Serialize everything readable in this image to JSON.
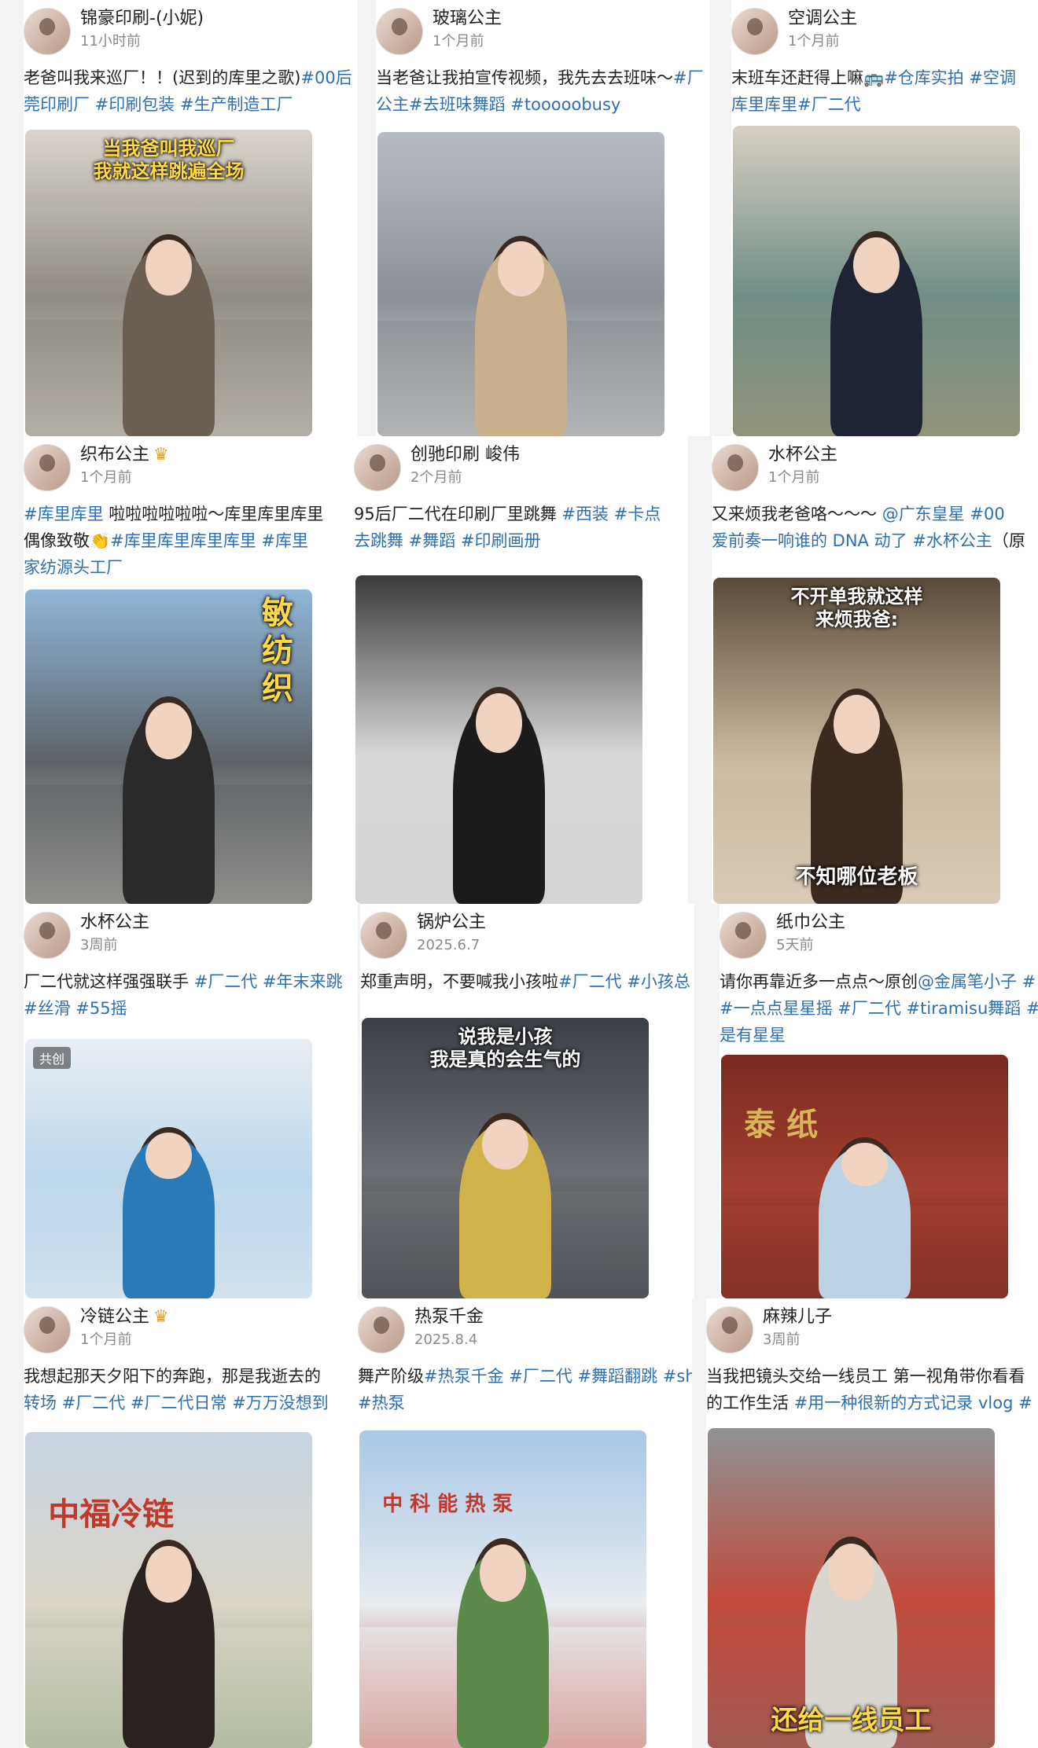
{
  "posts": [
    {
      "author": "锦豪印刷-(小妮)",
      "time": "11小时前",
      "crown": false,
      "caption_lines": [
        [
          {
            "t": "老爸叫我来巡厂！！(迟到的库里之歌)"
          },
          {
            "t": "#00后",
            "tag": true
          }
        ],
        [
          {
            "t": "莞印刷厂 #印刷包装 #生产制造工厂",
            "tag": true
          }
        ]
      ],
      "overlay": [
        "当我爸叫我巡厂",
        "我就这样跳遍全场"
      ],
      "overlay_color": "yellow",
      "bg": [
        "#d9d4cc",
        "#8f8a82",
        "#6b5e52",
        "#e8e3dc"
      ]
    },
    {
      "author": "玻璃公主",
      "time": "1个月前",
      "crown": false,
      "caption_lines": [
        [
          {
            "t": "当老爸让我拍宣传视频，我先去去班味～"
          },
          {
            "t": "#厂",
            "tag": true
          }
        ],
        [
          {
            "t": "公主#去班味舞蹈 #tooooobusy",
            "tag": true
          }
        ]
      ],
      "overlay": [],
      "overlay_color": "white",
      "bg": [
        "#b7bcc2",
        "#8c9197",
        "#c9b08c",
        "#e9e6e1"
      ]
    },
    {
      "author": "空调公主",
      "time": "1个月前",
      "crown": false,
      "caption_lines": [
        [
          {
            "t": "末班车还赶得上嘛🚌"
          },
          {
            "t": "#仓库实拍 #空调",
            "tag": true
          }
        ],
        [
          {
            "t": "库里库里#厂二代",
            "tag": true
          }
        ]
      ],
      "overlay": [],
      "overlay_color": "white",
      "bg": [
        "#d8cfc3",
        "#6f8d86",
        "#1e2433",
        "#c59a6e"
      ]
    },
    {
      "author": "织布公主",
      "time": "1个月前",
      "crown": true,
      "caption_lines": [
        [
          {
            "t": "#库里库里",
            "tag": true
          },
          {
            "t": " 啦啦啦啦啦啦～库里库里库里"
          }
        ],
        [
          {
            "t": "偶像致敬👏"
          },
          {
            "t": "#库里库里库里库里 #库里",
            "tag": true
          }
        ],
        [
          {
            "t": "家纺源头工厂",
            "tag": true
          }
        ]
      ],
      "overlay": [
        "敏",
        "纺",
        "织"
      ],
      "overlay_color": "yellow",
      "bg": [
        "#8fb6d9",
        "#5d6266",
        "#2a2a2a",
        "#d9cfc2"
      ]
    },
    {
      "author": "创驰印刷 峻伟",
      "time": "2个月前",
      "crown": false,
      "caption_lines": [
        [
          {
            "t": "95后厂二代在印刷厂里跳舞 "
          },
          {
            "t": "#西装 #卡点",
            "tag": true
          }
        ],
        [
          {
            "t": "去跳舞 #舞蹈 #印刷画册",
            "tag": true
          }
        ]
      ],
      "overlay": [],
      "overlay_color": "white",
      "bg": [
        "#3a3a3a",
        "#d8d8d8",
        "#1b1b1b",
        "#cfcfcf"
      ]
    },
    {
      "author": "水杯公主",
      "time": "1个月前",
      "crown": false,
      "caption_lines": [
        [
          {
            "t": "又来烦我老爸咯～～～ "
          },
          {
            "t": "@广东皇星 #00",
            "tag": true
          }
        ],
        [
          {
            "t": "爱前奏一响谁的 DNA 动了 #水杯公主",
            "tag": true
          },
          {
            "t": "（原"
          }
        ]
      ],
      "overlay": [
        "不开单我就这样",
        "来烦我爸:"
      ],
      "overlay_color": "white",
      "bottom_text": "不知哪位老板",
      "bg": [
        "#5a4a3a",
        "#c9b89f",
        "#3a2a20",
        "#efe7dc"
      ]
    },
    {
      "author": "水杯公主",
      "time": "3周前",
      "crown": false,
      "caption_lines": [
        [
          {
            "t": "厂二代就这样强强联手 "
          },
          {
            "t": "#厂二代 #年末来跳",
            "tag": true
          }
        ],
        [
          {
            "t": "#丝滑 #55摇",
            "tag": true
          }
        ]
      ],
      "overlay": [],
      "overlay_color": "white",
      "badge": "共创",
      "bg": [
        "#e9eef3",
        "#bcd6ea",
        "#2b7ab8",
        "#f4f4f4"
      ]
    },
    {
      "author": "锅炉公主",
      "time": "2025.6.7",
      "crown": false,
      "caption_lines": [
        [
          {
            "t": "郑重声明，不要喊我小孩啦"
          },
          {
            "t": "#厂二代 #小孩总",
            "tag": true
          }
        ]
      ],
      "overlay": [
        "说我是小孩",
        "我是真的会生气的"
      ],
      "overlay_color": "white",
      "bg": [
        "#3b3f46",
        "#6b6f74",
        "#d1b24a",
        "#2a2d33"
      ]
    },
    {
      "author": "纸巾公主",
      "time": "5天前",
      "crown": false,
      "caption_lines": [
        [
          {
            "t": "请你再靠近多一点点～原创"
          },
          {
            "t": "@金属笔小子 #",
            "tag": true
          }
        ],
        [
          {
            "t": "#一点点星星摇 #厂二代 #tiramisu舞蹈 #为",
            "tag": true
          }
        ],
        [
          {
            "t": "是有星星",
            "tag": true
          }
        ]
      ],
      "overlay": [],
      "overlay_color": "white",
      "sign_text": "泰 纸",
      "bg": [
        "#7a2a1f",
        "#a24030",
        "#bcd3e6",
        "#5a1c15"
      ]
    },
    {
      "author": "冷链公主",
      "time": "1个月前",
      "crown": true,
      "caption_lines": [
        [
          {
            "t": "我想起那天夕阳下的奔跑，那是我逝去的"
          }
        ],
        [
          {
            "t": "转场 #厂二代 #厂二代日常 #万万没想到",
            "tag": true
          }
        ]
      ],
      "overlay": [],
      "overlay_color": "white",
      "sign_text": "中福冷链",
      "bg": [
        "#c7d4e2",
        "#d9d4c6",
        "#2a2220",
        "#7a9a70"
      ]
    },
    {
      "author": "热泵千金",
      "time": "2025.8.4",
      "crown": false,
      "caption_lines": [
        [
          {
            "t": "舞产阶级"
          },
          {
            "t": "#热泵千金 #厂二代 #舞蹈翻跳 #sh",
            "tag": true
          }
        ],
        [
          {
            "t": "#热泵",
            "tag": true
          }
        ]
      ],
      "overlay": [],
      "overlay_color": "white",
      "sign_text": "中 科 能 热 泵",
      "bg": [
        "#a9c7e6",
        "#e7ecef",
        "#5b8a4a",
        "#c23b2e"
      ]
    },
    {
      "author": "麻辣儿子",
      "time": "3周前",
      "crown": false,
      "caption_lines": [
        [
          {
            "t": "当我把镜头交给一线员工 第一视角带你看看"
          }
        ],
        [
          {
            "t": "的工作生活 "
          },
          {
            "t": "#用一种很新的方式记录 vlog #",
            "tag": true
          }
        ]
      ],
      "overlay": [
        "还给一线员工"
      ],
      "overlay_color": "yellow",
      "bg": [
        "#8e9296",
        "#c24a3a",
        "#d9d6cf",
        "#6f7377"
      ]
    }
  ],
  "icons": {
    "crown": "crown-icon",
    "avatar": "avatar-icon"
  },
  "colors": {
    "tag": "#2e6fb3",
    "time": "#8a8a8a",
    "background": "#f3f3f3"
  }
}
